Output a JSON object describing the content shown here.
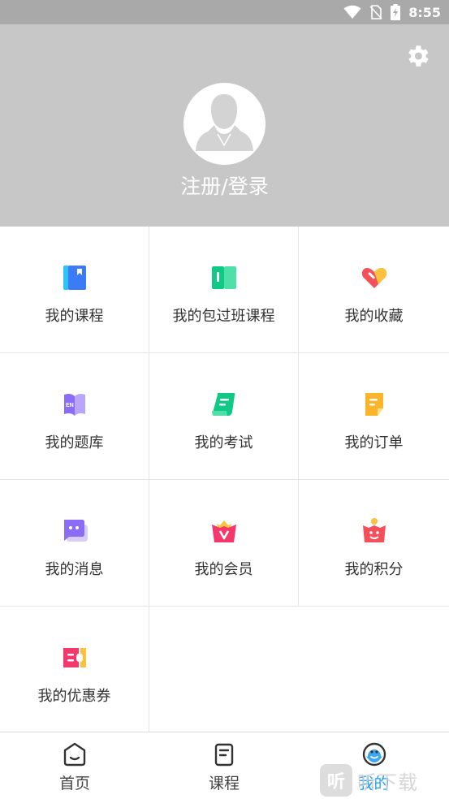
{
  "status_bar": {
    "time": "8:55"
  },
  "header": {
    "login_text": "注册/登录"
  },
  "menu": {
    "items": [
      {
        "label": "我的课程",
        "icon": "book-icon",
        "color": "#3b82f6"
      },
      {
        "label": "我的包过班课程",
        "icon": "open-book-icon",
        "color": "#10c987"
      },
      {
        "label": "我的收藏",
        "icon": "heart-tag-icon",
        "color": "#f5505a"
      },
      {
        "label": "我的题库",
        "icon": "question-bank-icon",
        "color": "#8b6cf6"
      },
      {
        "label": "我的考试",
        "icon": "exam-scroll-icon",
        "color": "#10c987"
      },
      {
        "label": "我的订单",
        "icon": "order-note-icon",
        "color": "#fbb52b"
      },
      {
        "label": "我的消息",
        "icon": "message-bubble-icon",
        "color": "#8b6cf6"
      },
      {
        "label": "我的会员",
        "icon": "vip-crown-icon",
        "color": "#f5386b"
      },
      {
        "label": "我的积分",
        "icon": "points-bag-icon",
        "color": "#f5505a"
      },
      {
        "label": "我的优惠券",
        "icon": "coupon-icon",
        "color": "#f5386b"
      }
    ]
  },
  "tabbar": {
    "tabs": [
      {
        "label": "首页",
        "icon": "home-icon",
        "active": false
      },
      {
        "label": "课程",
        "icon": "course-icon",
        "active": false
      },
      {
        "label": "我的",
        "icon": "profile-smiley-icon",
        "active": true
      }
    ],
    "active_color": "#1a9bf0"
  },
  "watermark": {
    "text": "听下载",
    "glyph": "听"
  }
}
